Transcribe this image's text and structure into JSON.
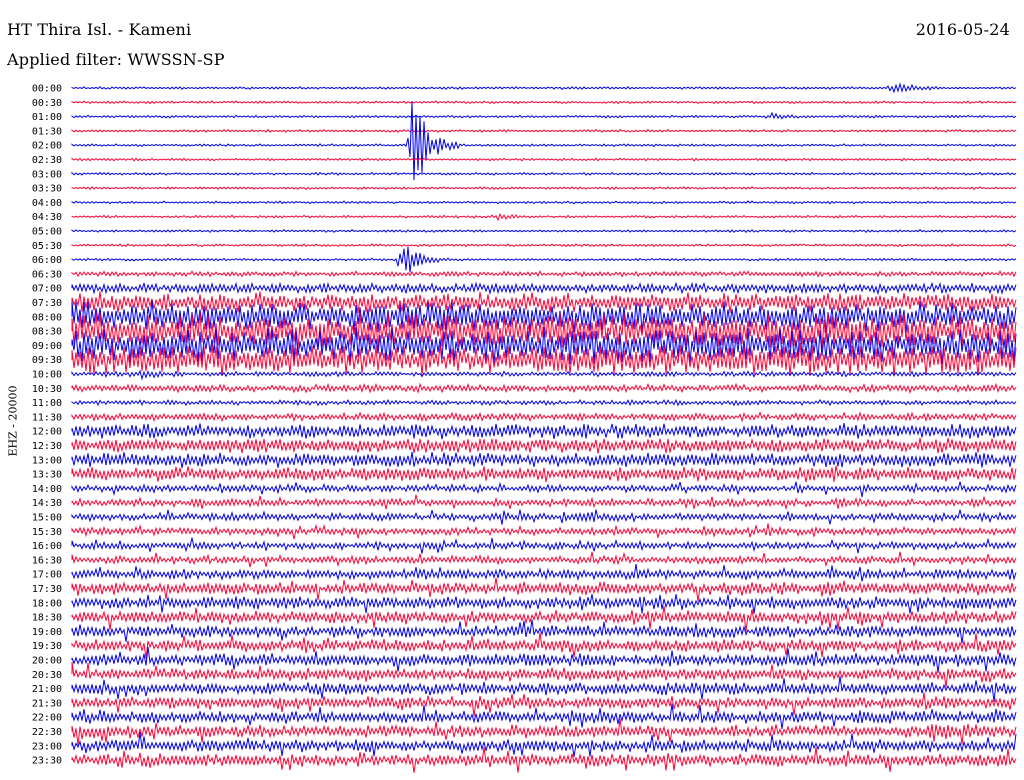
{
  "header": {
    "station": "HT Thira Isl. - Kameni",
    "date": "2016-05-24",
    "filter_label": "Applied filter:",
    "filter_value": "WWSSN-SP"
  },
  "channel_label": "EHZ - 20000",
  "colors": {
    "trace_a": "#0000ee",
    "trace_b": "#ff0033",
    "background": "#ffffff",
    "text": "#000000"
  },
  "chart_data": {
    "type": "helicorder",
    "time_labels": [
      "00:00",
      "00:30",
      "01:00",
      "01:30",
      "02:00",
      "02:30",
      "03:00",
      "03:30",
      "04:00",
      "04:30",
      "05:00",
      "05:30",
      "06:00",
      "06:30",
      "07:00",
      "07:30",
      "08:00",
      "08:30",
      "09:00",
      "09:30",
      "10:00",
      "10:30",
      "11:00",
      "11:30",
      "12:00",
      "12:30",
      "13:00",
      "13:30",
      "14:00",
      "14:30",
      "15:00",
      "15:30",
      "16:00",
      "16:30",
      "17:00",
      "17:30",
      "18:00",
      "18:30",
      "19:00",
      "19:30",
      "20:00",
      "20:30",
      "21:00",
      "21:30",
      "22:00",
      "22:30",
      "23:00",
      "23:30"
    ],
    "line_colors_alternate": [
      "blue",
      "red"
    ],
    "relative_noise_level": [
      1,
      1,
      1,
      1,
      1,
      1,
      1,
      1,
      1,
      1,
      1,
      1,
      1,
      2,
      4,
      8,
      12,
      14,
      14,
      12,
      2,
      3,
      2,
      3,
      6,
      6,
      6,
      6,
      3,
      3,
      3,
      3,
      3,
      3,
      4,
      5,
      5,
      5,
      5,
      5,
      5,
      5,
      5,
      5,
      5,
      5,
      5,
      5
    ],
    "events": [
      {
        "row": 0,
        "t": 0.87,
        "amplitude": 8
      },
      {
        "row": 2,
        "t": 0.74,
        "amplitude": 3
      },
      {
        "row": 4,
        "t": 0.36,
        "amplitude": 60
      },
      {
        "row": 9,
        "t": 0.45,
        "amplitude": 3
      },
      {
        "row": 12,
        "t": 0.35,
        "amplitude": 20
      },
      {
        "row": 20,
        "t": 0.07,
        "amplitude": 4
      },
      {
        "row": 30,
        "t": 0.54,
        "amplitude": 5
      },
      {
        "row": 45,
        "t": 0.91,
        "amplitude": 10
      }
    ]
  }
}
